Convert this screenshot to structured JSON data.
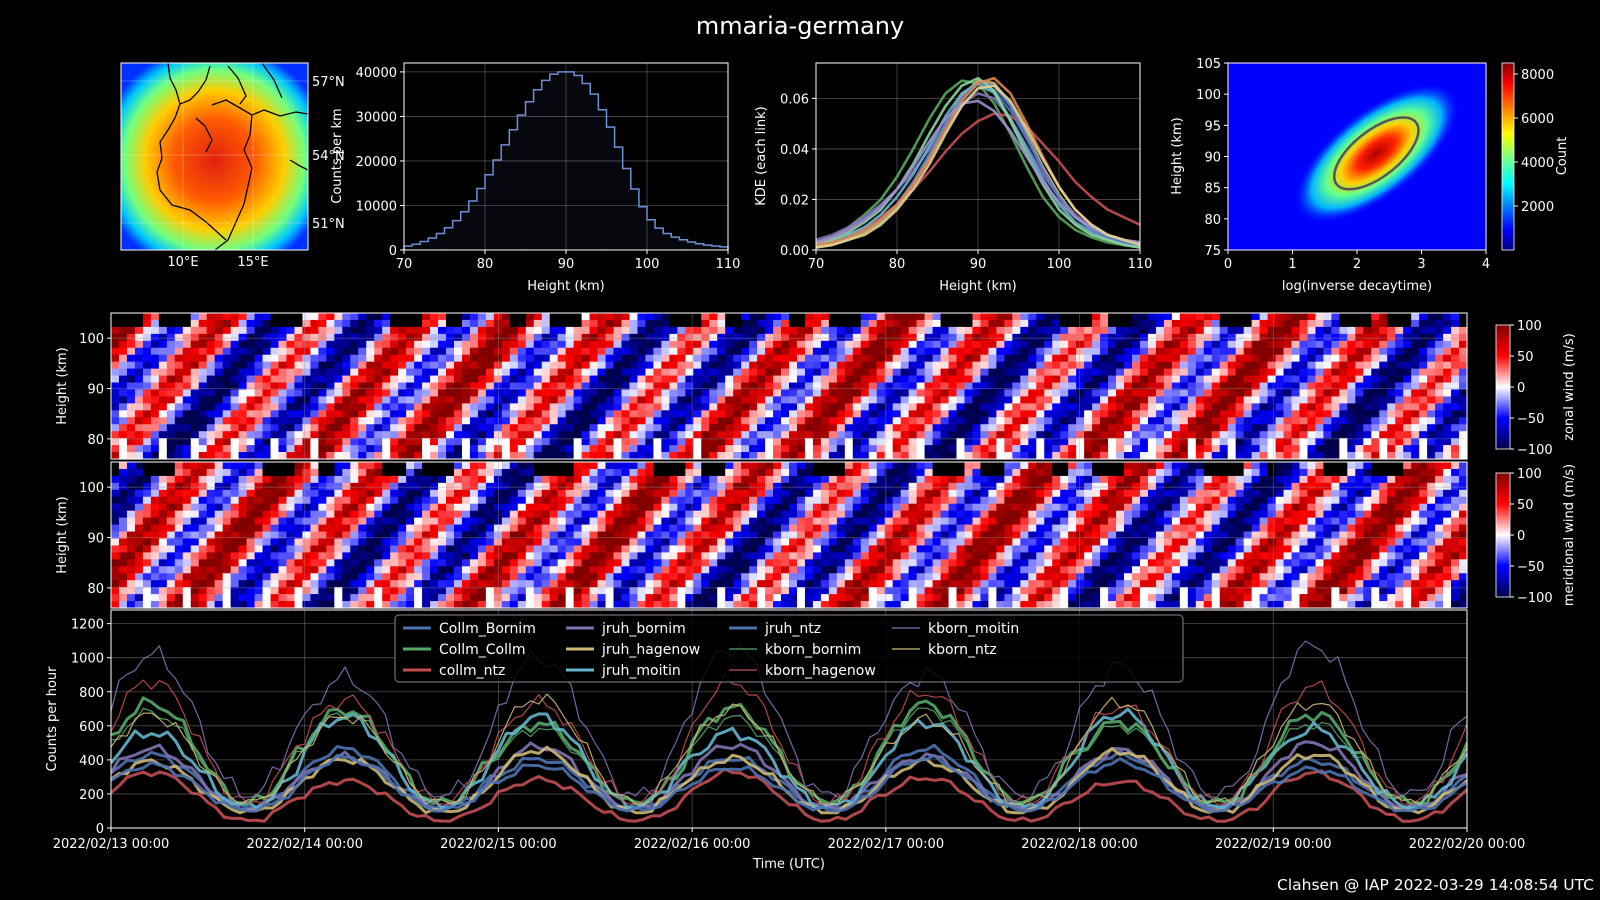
{
  "figure": {
    "title": "mmaria-germany",
    "footer": "Clahsen @ IAP 2022-03-29 14:08:54 UTC"
  },
  "chart_data": [
    {
      "type": "heatmap",
      "id": "map",
      "xticks": [
        "10°E",
        "15°E"
      ],
      "yticks": [
        "57°N",
        "54°N",
        "51°N"
      ]
    },
    {
      "type": "bar",
      "id": "height-histogram",
      "xlabel": "Height (km)",
      "ylabel": "Counts per km",
      "xlim": [
        70,
        110
      ],
      "ylim": [
        0,
        42000
      ],
      "xticks": [
        70,
        80,
        90,
        100,
        110
      ],
      "yticks": [
        0,
        10000,
        20000,
        30000,
        40000
      ],
      "bin_edges": [
        70,
        71,
        72,
        73,
        74,
        75,
        76,
        77,
        78,
        79,
        80,
        81,
        82,
        83,
        84,
        85,
        86,
        87,
        88,
        89,
        90,
        91,
        92,
        93,
        94,
        95,
        96,
        97,
        98,
        99,
        100,
        101,
        102,
        103,
        104,
        105,
        106,
        107,
        108,
        109,
        110
      ],
      "values": [
        900,
        1300,
        1900,
        2700,
        3700,
        5000,
        6600,
        8600,
        11000,
        13800,
        16900,
        20200,
        23600,
        27000,
        30300,
        33300,
        36000,
        38100,
        39500,
        40000,
        40000,
        39200,
        37400,
        35000,
        31500,
        27600,
        23100,
        18300,
        13700,
        9700,
        6800,
        4900,
        3700,
        2900,
        2300,
        1800,
        1400,
        1100,
        900,
        700
      ],
      "color": "#6f8fd6"
    },
    {
      "type": "line",
      "id": "kde",
      "xlabel": "Height (km)",
      "ylabel": "KDE (each link)",
      "xlim": [
        70,
        110
      ],
      "ylim": [
        0,
        0.074
      ],
      "xticks": [
        70,
        80,
        90,
        100,
        110
      ],
      "yticks": [
        "0.00",
        "0.02",
        "0.04",
        "0.06"
      ],
      "x": [
        70,
        72,
        74,
        76,
        78,
        80,
        82,
        84,
        86,
        88,
        90,
        92,
        94,
        96,
        98,
        100,
        102,
        104,
        106,
        108,
        110
      ],
      "series": [
        {
          "color": "#4f6fad",
          "values": [
            0.002,
            0.003,
            0.005,
            0.008,
            0.012,
            0.018,
            0.026,
            0.036,
            0.047,
            0.057,
            0.064,
            0.063,
            0.055,
            0.044,
            0.032,
            0.021,
            0.013,
            0.008,
            0.005,
            0.003,
            0.002
          ]
        },
        {
          "color": "#59a65c",
          "values": [
            0.003,
            0.005,
            0.009,
            0.014,
            0.02,
            0.029,
            0.04,
            0.052,
            0.062,
            0.067,
            0.066,
            0.058,
            0.046,
            0.033,
            0.021,
            0.013,
            0.008,
            0.005,
            0.003,
            0.002,
            0.001
          ]
        },
        {
          "color": "#c44e52",
          "values": [
            0.003,
            0.004,
            0.006,
            0.009,
            0.013,
            0.018,
            0.024,
            0.031,
            0.039,
            0.046,
            0.051,
            0.054,
            0.053,
            0.049,
            0.042,
            0.035,
            0.027,
            0.021,
            0.016,
            0.013,
            0.01
          ]
        },
        {
          "color": "#8172b2",
          "values": [
            0.004,
            0.006,
            0.009,
            0.013,
            0.018,
            0.024,
            0.031,
            0.04,
            0.05,
            0.058,
            0.062,
            0.06,
            0.052,
            0.041,
            0.03,
            0.021,
            0.014,
            0.009,
            0.006,
            0.004,
            0.003
          ]
        },
        {
          "color": "#ccb974",
          "values": [
            0.001,
            0.002,
            0.004,
            0.007,
            0.011,
            0.017,
            0.026,
            0.037,
            0.05,
            0.061,
            0.067,
            0.066,
            0.058,
            0.046,
            0.033,
            0.022,
            0.013,
            0.008,
            0.005,
            0.003,
            0.002
          ]
        },
        {
          "color": "#64b5cd",
          "values": [
            0.002,
            0.003,
            0.006,
            0.009,
            0.014,
            0.021,
            0.03,
            0.041,
            0.053,
            0.062,
            0.066,
            0.062,
            0.052,
            0.04,
            0.028,
            0.018,
            0.011,
            0.007,
            0.004,
            0.003,
            0.002
          ]
        },
        {
          "color": "#5a7bc6",
          "values": [
            0.002,
            0.003,
            0.005,
            0.008,
            0.012,
            0.018,
            0.027,
            0.038,
            0.05,
            0.06,
            0.066,
            0.065,
            0.057,
            0.045,
            0.032,
            0.021,
            0.013,
            0.008,
            0.005,
            0.003,
            0.002
          ]
        },
        {
          "color": "#8dd3a0",
          "values": [
            0.002,
            0.004,
            0.007,
            0.011,
            0.016,
            0.024,
            0.034,
            0.046,
            0.057,
            0.065,
            0.068,
            0.063,
            0.051,
            0.038,
            0.026,
            0.016,
            0.01,
            0.006,
            0.004,
            0.002,
            0.001
          ]
        },
        {
          "color": "#dd8452",
          "values": [
            0.002,
            0.003,
            0.005,
            0.008,
            0.012,
            0.018,
            0.026,
            0.036,
            0.048,
            0.059,
            0.066,
            0.068,
            0.062,
            0.05,
            0.037,
            0.025,
            0.016,
            0.01,
            0.006,
            0.004,
            0.003
          ]
        },
        {
          "color": "#9b8fd0",
          "values": [
            0.003,
            0.005,
            0.008,
            0.012,
            0.017,
            0.024,
            0.033,
            0.043,
            0.052,
            0.058,
            0.059,
            0.055,
            0.047,
            0.037,
            0.027,
            0.019,
            0.013,
            0.009,
            0.006,
            0.004,
            0.003
          ]
        },
        {
          "color": "#e0d28f",
          "values": [
            0.001,
            0.002,
            0.004,
            0.006,
            0.01,
            0.016,
            0.024,
            0.034,
            0.046,
            0.057,
            0.064,
            0.065,
            0.059,
            0.048,
            0.036,
            0.025,
            0.016,
            0.01,
            0.006,
            0.004,
            0.002
          ]
        }
      ]
    },
    {
      "type": "heatmap",
      "id": "decay-height",
      "xlabel": "log(inverse decaytime)",
      "ylabel": "Height (km)",
      "xlim": [
        0,
        4
      ],
      "ylim": [
        75,
        105
      ],
      "xticks": [
        0,
        1,
        2,
        3,
        4
      ],
      "yticks": [
        75,
        80,
        85,
        90,
        95,
        100,
        105
      ],
      "colorbar": {
        "label": "Count",
        "ticks": [
          2000,
          4000,
          6000,
          8000
        ],
        "range": [
          0,
          8500
        ]
      },
      "peak": {
        "x": 2.3,
        "y": 90.5,
        "value": 8200
      }
    },
    {
      "type": "heatmap",
      "id": "zonal-wind",
      "ylabel": "Height (km)",
      "ylim": [
        76,
        105
      ],
      "yticks": [
        80,
        90,
        100
      ],
      "colorbar": {
        "label": "zonal wind (m/s)",
        "ticks": [
          -100,
          -50,
          0,
          50,
          100
        ]
      }
    },
    {
      "type": "heatmap",
      "id": "meridional-wind",
      "ylabel": "Height (km)",
      "ylim": [
        76,
        105
      ],
      "yticks": [
        80,
        90,
        100
      ],
      "colorbar": {
        "label": "meridional wind (m/s)",
        "ticks": [
          -100,
          -50,
          0,
          50,
          100
        ]
      }
    },
    {
      "type": "line",
      "id": "counts-per-hour",
      "xlabel": "Time (UTC)",
      "ylabel": "Counts per hour",
      "xlim": [
        "2022/02/13 00:00",
        "2022/02/20 00:00"
      ],
      "ylim": [
        0,
        1280
      ],
      "yticks": [
        0,
        200,
        400,
        600,
        800,
        1000,
        1200
      ],
      "xticks": [
        "2022/02/13 00:00",
        "2022/02/14 00:00",
        "2022/02/15 00:00",
        "2022/02/16 00:00",
        "2022/02/17 00:00",
        "2022/02/18 00:00",
        "2022/02/19 00:00",
        "2022/02/20 00:00"
      ],
      "daily_minimum_hour": 17,
      "series": [
        {
          "name": "Collm_Bornim",
          "color": "#4c72b0",
          "width": 3,
          "min": 120,
          "max": 430
        },
        {
          "name": "Collm_Collm",
          "color": "#55a868",
          "width": 3,
          "min": 140,
          "max": 680
        },
        {
          "name": "collm_ntz",
          "color": "#c44e52",
          "width": 3,
          "min": 40,
          "max": 300
        },
        {
          "name": "jruh_bornim",
          "color": "#8172b2",
          "width": 3,
          "min": 110,
          "max": 460
        },
        {
          "name": "jruh_hagenow",
          "color": "#ccb974",
          "width": 3,
          "min": 90,
          "max": 420
        },
        {
          "name": "jruh_moitin",
          "color": "#64b5cd",
          "width": 3,
          "min": 120,
          "max": 620
        },
        {
          "name": "jruh_ntz",
          "color": "#4c72b0",
          "width": 3,
          "min": 100,
          "max": 380
        },
        {
          "name": "kborn_bornim",
          "color": "#55a868",
          "width": 1.2,
          "min": 150,
          "max": 640
        },
        {
          "name": "kborn_hagenow",
          "color": "#c44e52",
          "width": 1.2,
          "min": 140,
          "max": 790
        },
        {
          "name": "kborn_moitin",
          "color": "#8172b2",
          "width": 1.2,
          "min": 180,
          "max": 980
        },
        {
          "name": "kborn_ntz",
          "color": "#ccb974",
          "width": 1.2,
          "min": 140,
          "max": 700
        }
      ]
    }
  ]
}
